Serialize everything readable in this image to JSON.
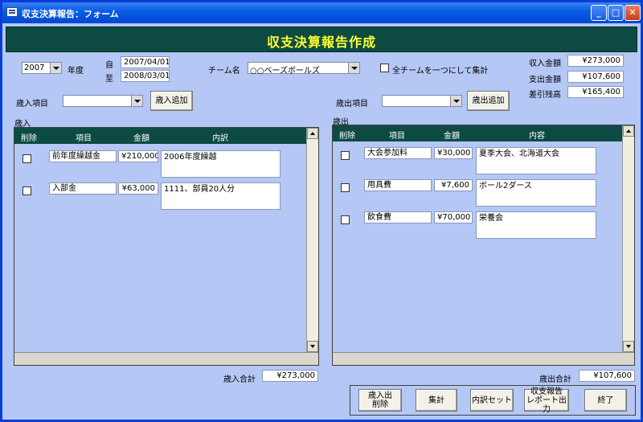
{
  "window": {
    "title": "収支決算報告：フォーム",
    "icon": "form-icon",
    "controls": {
      "minimize": "_",
      "maximize": "□",
      "close": "✕"
    }
  },
  "header": {
    "title": "収支決算報告作成"
  },
  "filters": {
    "year_value": "2007",
    "year_label": "年度",
    "from_label": "自",
    "from_date": "2007/04/01",
    "to_label": "至",
    "to_date": "2008/03/01",
    "team_label": "チーム名",
    "team_value": "○○ベーズボールズ",
    "aggregate_label": "全チームを一つにして集計"
  },
  "summary": [
    {
      "label": "収入金額",
      "value": "¥273,000"
    },
    {
      "label": "支出金額",
      "value": "¥107,600"
    },
    {
      "label": "差引残高",
      "value": "¥165,400"
    }
  ],
  "income": {
    "item_label": "歳入項目",
    "add_button": "歳入追加",
    "section_label": "歳入",
    "columns": {
      "delete": "削除",
      "item": "項目",
      "amount": "金額",
      "detail": "内訳"
    },
    "rows": [
      {
        "item": "前年度繰越金",
        "amount": "¥210,000",
        "detail": "2006年度繰越"
      },
      {
        "item": "入部金",
        "amount": "¥63,000",
        "detail": "1111、部員20人分"
      }
    ],
    "total_label": "歳入合計",
    "total_value": "¥273,000"
  },
  "expense": {
    "item_label": "歳出項目",
    "add_button": "歳出追加",
    "section_label": "歳出",
    "columns": {
      "delete": "削除",
      "item": "項目",
      "amount": "金額",
      "detail": "内容"
    },
    "rows": [
      {
        "item": "大会参加料",
        "amount": "¥30,000",
        "detail": "夏季大会、北海道大会"
      },
      {
        "item": "用具費",
        "amount": "¥7,600",
        "detail": "ボール2ダース"
      },
      {
        "item": "飲食費",
        "amount": "¥70,000",
        "detail": "栄養会"
      }
    ],
    "total_label": "歳出合計",
    "total_value": "¥107,600"
  },
  "actions": {
    "delete_all_l1": "歳入出",
    "delete_all_l2": "削除",
    "aggregate": "集計",
    "reset_detail": "内訳セット",
    "report_l1": "収支報告",
    "report_l2": "レポート出力",
    "exit": "終了"
  }
}
